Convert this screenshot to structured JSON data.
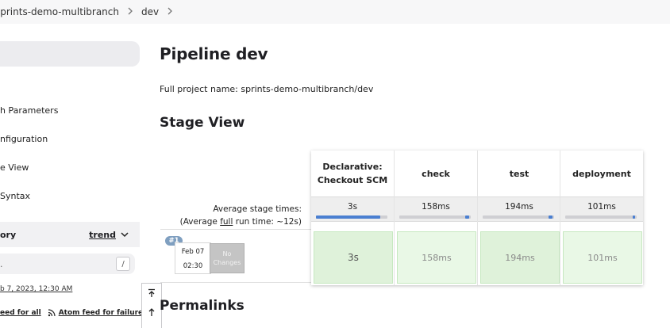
{
  "breadcrumb": {
    "items": [
      "sprints-demo-multibranch",
      "dev"
    ],
    "separator": ">"
  },
  "sidebar": {
    "tasks": [
      "h Parameters",
      "nfiguration",
      "e View",
      "Syntax"
    ],
    "build_history": {
      "title": "ory",
      "trend_label": "trend"
    },
    "filter": {
      "placeholder": ".",
      "shortcut": "/"
    },
    "last_build_link": "b 7, 2023, 12:30 AM",
    "feeds": {
      "all": "eed for all",
      "failures": "Atom feed for failures"
    }
  },
  "main": {
    "title": "Pipeline dev",
    "full_project_name": "Full project name: sprints-demo-multibranch/dev",
    "stage_view_title": "Stage View",
    "permalinks_title": "Permalinks",
    "avg_label": {
      "line1": "Average stage times:",
      "line2_prefix": "(Average ",
      "line2_link": "full",
      "line2_suffix": " run time: ~12s)"
    }
  },
  "stage_view": {
    "stages": [
      {
        "name_line1": "Declarative:",
        "name_line2": "Checkout SCM",
        "avg": "3s",
        "progress": 0.9,
        "cell": "3s"
      },
      {
        "name_line1": "check",
        "name_line2": "",
        "avg": "158ms",
        "progress": 0.05,
        "cell": "158ms"
      },
      {
        "name_line1": "test",
        "name_line2": "",
        "avg": "194ms",
        "progress": 0.06,
        "cell": "194ms"
      },
      {
        "name_line1": "deployment",
        "name_line2": "",
        "avg": "101ms",
        "progress": 0.03,
        "cell": "101ms"
      }
    ],
    "build": {
      "number": "#1",
      "date": "Feb 07",
      "time": "02:30",
      "changes": "No Changes"
    }
  },
  "colors": {
    "progress": "#4a7fd1",
    "cell_fill_dark": "#dff2da",
    "cell_fill_light": "#e9f8e6",
    "cell_border": "#c6e8c0",
    "badge": "#7f9fc0"
  },
  "icons": {
    "breadcrumb_chevron": "chevron-right-icon",
    "trend_chevron": "chevron-down-icon",
    "rss": "rss-icon",
    "scroll_top": "arrow-to-top-icon",
    "scroll_up": "arrow-up-icon"
  }
}
